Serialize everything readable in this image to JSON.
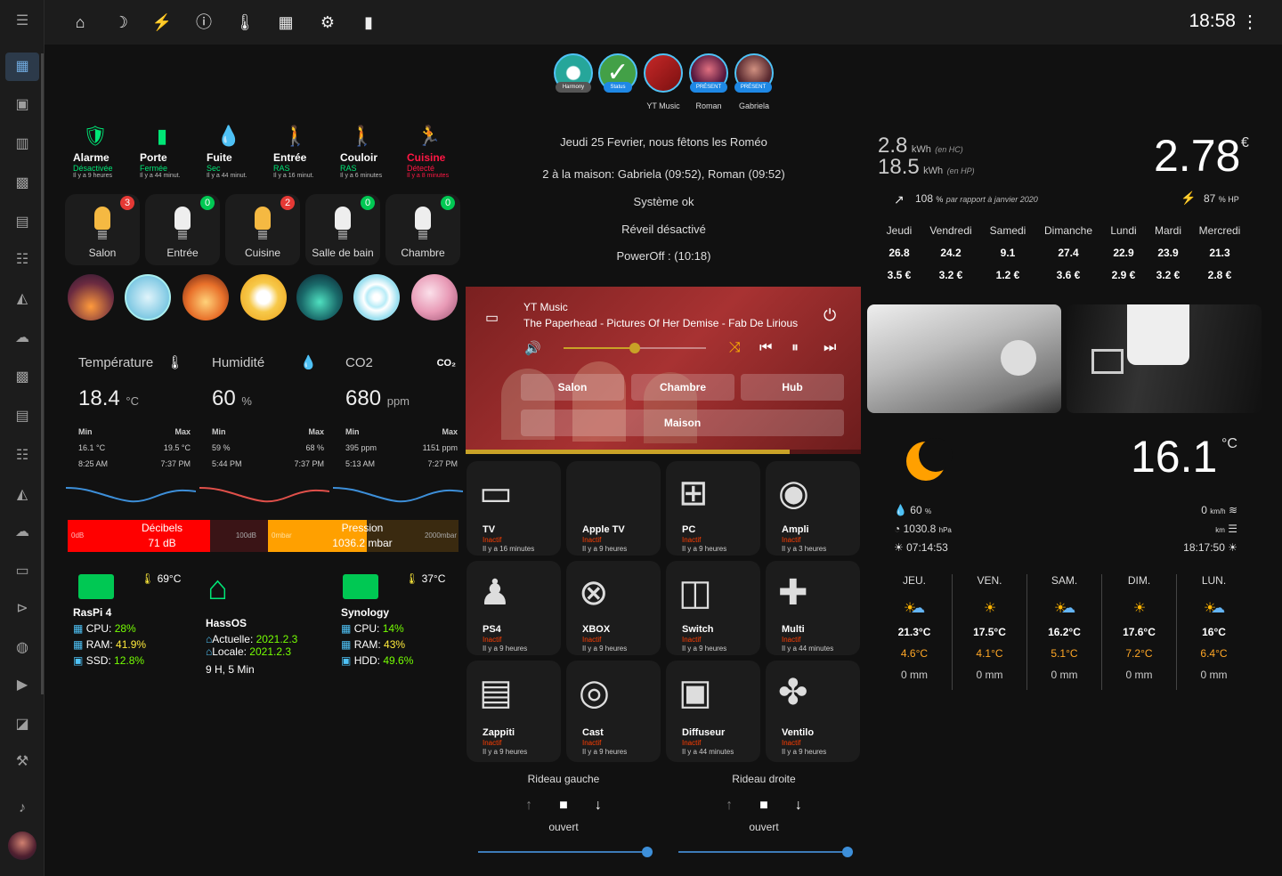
{
  "topbar": {
    "clock": "18:58"
  },
  "sensors": [
    {
      "name": "Alarme",
      "state": "Désactivée",
      "time": "Il y a 9 heures",
      "color": "#00e676"
    },
    {
      "name": "Porte",
      "state": "Fermée",
      "time": "Il y a 44 minut.",
      "color": "#00e676"
    },
    {
      "name": "Fuite",
      "state": "Sec",
      "time": "Il y a 44 minut.",
      "color": "#00e676"
    },
    {
      "name": "Entrée",
      "state": "RAS",
      "time": "Il y a 16 minut.",
      "color": "#00e676"
    },
    {
      "name": "Couloir",
      "state": "RAS",
      "time": "Il y a 6 minutes",
      "color": "#00e676"
    },
    {
      "name": "Cuisine",
      "state": "Détecté",
      "time": "Il y a 8 minutes",
      "color": "#ff1744"
    }
  ],
  "lights": [
    {
      "name": "Salon",
      "badge": "3",
      "badge_color": "#e53935",
      "bulb": "#f5b942"
    },
    {
      "name": "Entrée",
      "badge": "0",
      "badge_color": "#00c853",
      "bulb": "#eeeeee"
    },
    {
      "name": "Cuisine",
      "badge": "2",
      "badge_color": "#e53935",
      "bulb": "#f5b942"
    },
    {
      "name": "Salle de bain",
      "badge": "0",
      "badge_color": "#00c853",
      "bulb": "#eeeeee"
    },
    {
      "name": "Chambre",
      "badge": "0",
      "badge_color": "#00c853",
      "bulb": "#eeeeee"
    }
  ],
  "climate": [
    {
      "title": "Température",
      "value": "18.4",
      "unit": "°C",
      "min_label": "Min",
      "max_label": "Max",
      "min": "16.1 °C",
      "max": "19.5 °C",
      "min_time": "8:25 AM",
      "max_time": "7:37 PM"
    },
    {
      "title": "Humidité",
      "value": "60",
      "unit": "%",
      "min_label": "Min",
      "max_label": "Max",
      "min": "59 %",
      "max": "68 %",
      "min_time": "5:44 PM",
      "max_time": "7:37 PM"
    },
    {
      "title": "CO2",
      "icon_text": "CO₂",
      "value": "680",
      "unit": "ppm",
      "min_label": "Min",
      "max_label": "Max",
      "min": "395 ppm",
      "max": "1151 ppm",
      "min_time": "5:13 AM",
      "max_time": "7:27 PM"
    }
  ],
  "bars": {
    "decibel": {
      "label": "Décibels",
      "value": "71 dB",
      "min": "0dB",
      "max": "100dB",
      "fill": 0.71
    },
    "pressure": {
      "label": "Pression",
      "value": "1036.2 mbar",
      "min": "0mbar",
      "max": "2000mbar",
      "fill": 0.52
    }
  },
  "systems": {
    "raspi": {
      "name": "RasPi 4",
      "temp": "69°C",
      "cpu_label": "CPU:",
      "cpu": "28%",
      "ram_label": "RAM:",
      "ram": "41.9%",
      "ssd_label": "SSD:",
      "ssd": "12.8%"
    },
    "hassos": {
      "name": "HassOS",
      "actuelle_label": "Actuelle:",
      "actuelle": "2021.2.3",
      "locale_label": "Locale:",
      "locale": "2021.2.3",
      "uptime": "9 H, 5 Min"
    },
    "synology": {
      "name": "Synology",
      "temp": "37°C",
      "cpu_label": "CPU:",
      "cpu": "14%",
      "ram_label": "RAM:",
      "ram": "43%",
      "hdd_label": "HDD:",
      "hdd": "49.6%"
    }
  },
  "presence": [
    {
      "label": "Harmony",
      "name": ""
    },
    {
      "label": "Status",
      "name": ""
    },
    {
      "label": "",
      "name": "YT Music"
    },
    {
      "label": "PRÉSENT",
      "name": "Roman"
    },
    {
      "label": "PRÉSENT",
      "name": "Gabriela"
    }
  ],
  "info": {
    "line1": "Jeudi 25 Fevrier, nous fêtons les Roméo",
    "line2": "2 à la maison: Gabriela (09:52), Roman (09:52)",
    "line3": "Système ok",
    "line4": "Réveil désactivé",
    "line5": "PowerOff : (10:18)"
  },
  "player": {
    "source": "YT Music",
    "track": "The Paperhead - Pictures Of Her Demise - Fab De Lirious",
    "volume": 0.5,
    "progress": 0.82,
    "rooms": [
      "Salon",
      "Chambre",
      "Hub"
    ],
    "all": "Maison"
  },
  "devices": [
    {
      "name": "TV",
      "state": "Inactif",
      "time": "Il y a 16 minutes",
      "icon": "tv-icon",
      "glyph": "▭"
    },
    {
      "name": "Apple TV",
      "state": "Inactif",
      "time": "Il y a 9 heures",
      "icon": "apple-icon",
      "glyph": ""
    },
    {
      "name": "PC",
      "state": "Inactif",
      "time": "Il y a 9 heures",
      "icon": "windows-icon",
      "glyph": "⊞"
    },
    {
      "name": "Ampli",
      "state": "Inactif",
      "time": "Il y a 3 heures",
      "icon": "speaker-icon",
      "glyph": "◉"
    },
    {
      "name": "PS4",
      "state": "Inactif",
      "time": "Il y a 9 heures",
      "icon": "playstation-icon",
      "glyph": "♟"
    },
    {
      "name": "XBOX",
      "state": "Inactif",
      "time": "Il y a 9 heures",
      "icon": "xbox-icon",
      "glyph": "⊗"
    },
    {
      "name": "Switch",
      "state": "Inactif",
      "time": "Il y a 9 heures",
      "icon": "switch-icon",
      "glyph": "◫"
    },
    {
      "name": "Multi",
      "state": "Inactif",
      "time": "Il y a 44 minutes",
      "icon": "gamepad-icon",
      "glyph": "✚"
    },
    {
      "name": "Zappiti",
      "state": "Inactif",
      "time": "Il y a 9 heures",
      "icon": "clapperboard-icon",
      "glyph": "▤"
    },
    {
      "name": "Cast",
      "state": "Inactif",
      "time": "Il y a 9 heures",
      "icon": "chrome-icon",
      "glyph": "◎"
    },
    {
      "name": "Diffuseur",
      "state": "Inactif",
      "time": "Il y a 44 minutes",
      "icon": "diffuser-icon",
      "glyph": "▣"
    },
    {
      "name": "Ventilo",
      "state": "Inactif",
      "time": "Il y a 9 heures",
      "icon": "fan-icon",
      "glyph": "✤"
    }
  ],
  "curtains": [
    {
      "name": "Rideau gauche",
      "state": "ouvert",
      "position": 1.0
    },
    {
      "name": "Rideau droite",
      "state": "ouvert",
      "position": 1.0
    }
  ],
  "energy": {
    "hc": "2.8",
    "hc_unit": "kWh",
    "hc_note": "(en HC)",
    "hp": "18.5",
    "hp_unit": "kWh",
    "hp_note": "(en HP)",
    "cost": "2.78",
    "currency": "€",
    "pct": "108",
    "pct_unit": "%",
    "compare": "par rapport à janvier 2020",
    "hp_pct": "87",
    "hp_pct_unit": "% HP"
  },
  "week": [
    {
      "day": "Jeudi",
      "kwh": "26.8",
      "eur": "3.5 €"
    },
    {
      "day": "Vendredi",
      "kwh": "24.2",
      "eur": "3.2 €"
    },
    {
      "day": "Samedi",
      "kwh": "9.1",
      "eur": "1.2 €"
    },
    {
      "day": "Dimanche",
      "kwh": "27.4",
      "eur": "3.6 €"
    },
    {
      "day": "Lundi",
      "kwh": "22.9",
      "eur": "2.9 €"
    },
    {
      "day": "Mardi",
      "kwh": "23.9",
      "eur": "3.2 €"
    },
    {
      "day": "Mercredi",
      "kwh": "21.3",
      "eur": "2.8 €"
    }
  ],
  "weather": {
    "temp": "16.1",
    "unit": "°C",
    "humidity": "60",
    "humidity_unit": "%",
    "pressure": "1030.8",
    "pressure_unit": "hPa",
    "sunrise": "07:14:53",
    "wind": "0",
    "wind_unit": "km/h",
    "vis_unit": "km",
    "sunset": "18:17:50"
  },
  "forecast": [
    {
      "day": "JEU.",
      "hi": "21.3°C",
      "lo": "4.6°C",
      "rain": "0 mm",
      "icon": "partly-cloudy-icon"
    },
    {
      "day": "VEN.",
      "hi": "17.5°C",
      "lo": "4.1°C",
      "rain": "0 mm",
      "icon": "sun-icon"
    },
    {
      "day": "SAM.",
      "hi": "16.2°C",
      "lo": "5.1°C",
      "rain": "0 mm",
      "icon": "partly-cloudy-icon"
    },
    {
      "day": "DIM.",
      "hi": "17.6°C",
      "lo": "7.2°C",
      "rain": "0 mm",
      "icon": "sun-icon"
    },
    {
      "day": "LUN.",
      "hi": "16°C",
      "lo": "6.4°C",
      "rain": "0 mm",
      "icon": "partly-cloudy-icon"
    }
  ]
}
